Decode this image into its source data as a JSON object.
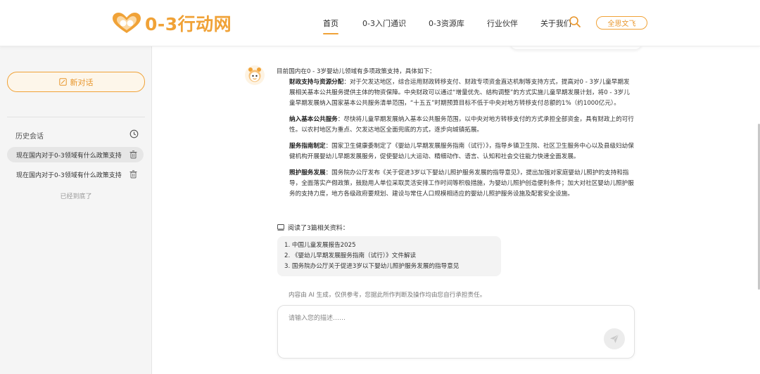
{
  "header": {
    "logo_text": "0-3行动网",
    "nav": [
      {
        "label": "首页",
        "active": true
      },
      {
        "label": "0-3入门通识",
        "active": false
      },
      {
        "label": "0-3资源库",
        "active": false
      },
      {
        "label": "行业伙伴",
        "active": false
      },
      {
        "label": "关于我们",
        "active": false
      }
    ],
    "user_name": "全思文飞"
  },
  "sidebar": {
    "new_chat_label": "新对话",
    "history_title": "历史会话",
    "history": [
      {
        "title": "现在国内对于0-3领域有什么政策支持",
        "selected": true
      },
      {
        "title": "现在国内对于0-3领域有什么政策支持",
        "selected": false
      }
    ],
    "end_text": "已经到底了"
  },
  "chat": {
    "intro": "目前国内在0 - 3岁婴幼儿领域有多项政策支持，具体如下：",
    "paragraphs": [
      {
        "title": "财政支持与资源分配",
        "text": "：对于欠发达地区，综合运用财政转移支付、财政专项资金直达机制等支持方式，提高对0 - 3岁儿童早期发展相关基本公共服务提供主体的物资保障。中央财政可以通过“增量优先、结构调整”的方式实施儿童早期发展计划，将0 - 3岁儿童早期发展纳入国家基本公共服务清单范围，“十五五”时期预算目标不低于中央对地方转移支付总额的1%（约1000亿元）。"
      },
      {
        "title": "纳入基本公共服务",
        "text": "：尽快将儿童早期发展纳入基本公共服务范围，以中央对地方转移支付的方式承担全部资金，具有财政上的可行性。以农村地区为重点、欠发达地区全面兜底的方式，逐步向城镇拓展。"
      },
      {
        "title": "服务指南制定",
        "text": "：国家卫生健康委制定了《婴幼儿早期发展服务指南（试行）》，指导乡镇卫生院、社区卫生服务中心以及县级妇幼保健机构开展婴幼儿早期发展服务，促使婴幼儿大运动、精细动作、语言、认知和社会交往能力快速全面发展。"
      },
      {
        "title": "照护服务发展",
        "text": "：国务院办公厅发布《关于促进3岁以下婴幼儿照护服务发展的指导意见》，提出加强对家庭婴幼儿照护的支持和指导，全面落实产假政策，鼓励用人单位采取灵活安排工作时间等积极措施，为婴幼儿照护创造便利条件；加大对社区婴幼儿照护服务的支持力度，地方各级政府要规划、建设与常住人口规模相适应的婴幼儿照护服务设施及配套安全设施。"
      }
    ],
    "refs_title": "阅读了3篇相关资料：",
    "refs": [
      "1. 中国儿童发展报告2025",
      "2. 《婴幼儿早期发展服务指南（试行）》文件解读",
      "3. 国务院办公厅关于促进3岁以下婴幼儿照护服务发展的指导意见"
    ],
    "disclaimer": "内容由 AI 生成，仅供参考，您据此所作判断及操作均由您自行承担责任。",
    "input_placeholder": "请输入您的描述……"
  },
  "colors": {
    "accent": "#f0a237",
    "sidebar_bg": "#f5f5f5"
  },
  "icons": [
    "search-icon",
    "edit-icon",
    "history-icon",
    "trash-icon",
    "book-icon",
    "send-icon",
    "robot-avatar-icon"
  ]
}
